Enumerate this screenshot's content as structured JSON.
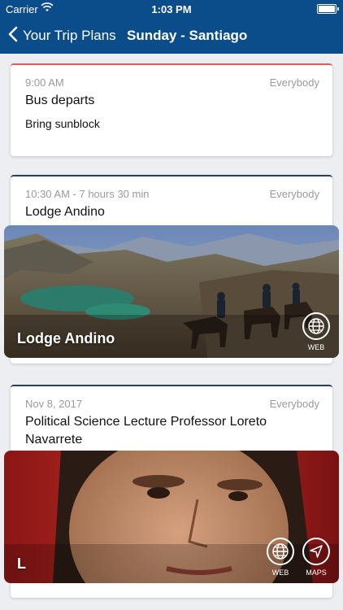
{
  "status_bar": {
    "carrier": "Carrier",
    "time": "1:03 PM"
  },
  "nav": {
    "back_label": "Your Trip Plans",
    "title": "Sunday - Santiago"
  },
  "items": [
    {
      "time": "9:00 AM",
      "audience": "Everybody",
      "title": "Bus departs",
      "note": "Bring sunblock"
    },
    {
      "time": "10:30 AM - 7 hours 30 min",
      "audience": "Everybody",
      "title": "Lodge Andino",
      "image_label": "Lodge Andino",
      "controls": [
        {
          "label": "WEB",
          "icon": "globe-icon"
        }
      ]
    },
    {
      "time": "Nov 8, 2017",
      "audience": "Everybody",
      "title": "Political Science Lecture Professor Loreto Navarrete",
      "image_label": "L",
      "controls": [
        {
          "label": "WEB",
          "icon": "globe-icon"
        },
        {
          "label": "MAPS",
          "icon": "navigation-arrow-icon"
        }
      ]
    }
  ],
  "colors": {
    "header": "#0b4d8a",
    "card_accent_1": "#e05a5a",
    "card_accent_2": "#2a3f5c",
    "background": "#eceef1"
  }
}
